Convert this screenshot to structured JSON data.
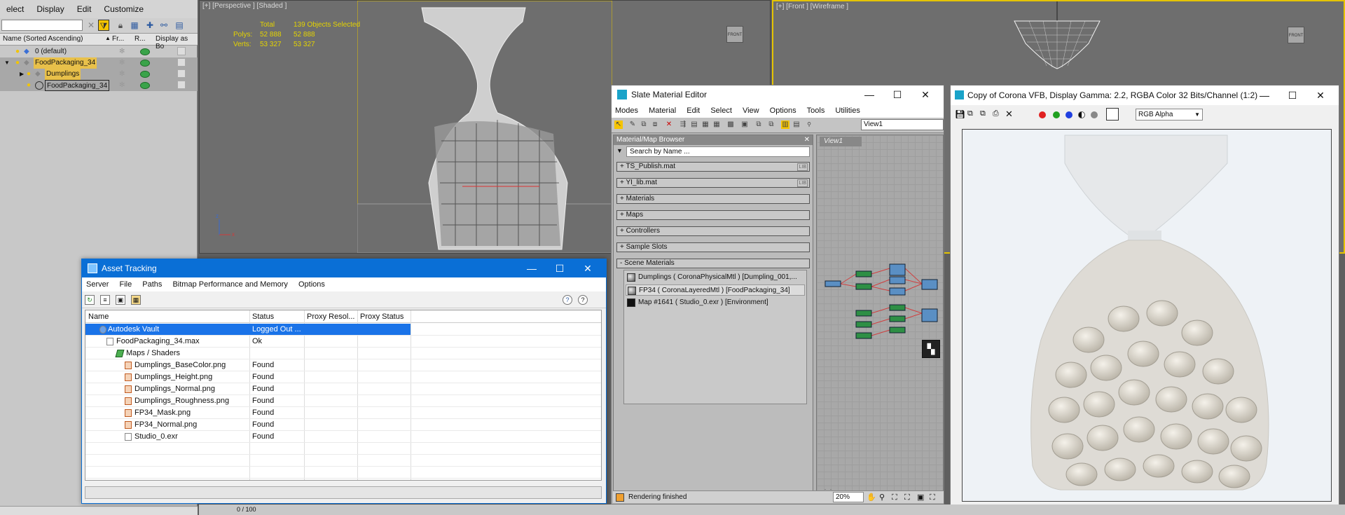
{
  "explorer": {
    "menu": [
      "elect",
      "Display",
      "Edit",
      "Customize"
    ],
    "columns": [
      "Name (Sorted Ascending)",
      "Fr...",
      "R...",
      "Display as Bo"
    ],
    "rows": [
      {
        "name": "0 (default)",
        "level": 0,
        "selected": false
      },
      {
        "name": "FoodPackaging_34",
        "level": 0,
        "selected": true
      },
      {
        "name": "Dumplings",
        "level": 1,
        "selected": true
      },
      {
        "name": "FoodPackaging_34",
        "level": 1,
        "selected": false,
        "boxed": true
      }
    ]
  },
  "viewport_persp": {
    "label": "[+] [Perspective ] [Shaded ]",
    "stats_header_total": "Total",
    "stats_header_selected": "139 Objects Selected",
    "polys_label": "Polys:",
    "polys_total": "52 888",
    "polys_selected": "52 888",
    "verts_label": "Verts:",
    "verts_total": "53 327",
    "verts_selected": "53 327",
    "cube": "FRONT"
  },
  "viewport_front": {
    "label": "[+] [Front ] [Wireframe ]",
    "cube": "FRONT"
  },
  "asset": {
    "title": "Asset Tracking",
    "menu": [
      "Server",
      "File",
      "Paths",
      "Bitmap Performance and Memory",
      "Options"
    ],
    "columns": [
      "Name",
      "Status",
      "Proxy Resol...",
      "Proxy Status"
    ],
    "rows": [
      {
        "name": "Autodesk Vault",
        "status": "Logged Out ...",
        "indent": 0,
        "type": "vault"
      },
      {
        "name": "FoodPackaging_34.max",
        "status": "Ok",
        "indent": 1,
        "type": "file"
      },
      {
        "name": "Maps / Shaders",
        "status": "",
        "indent": 2,
        "type": "folder"
      },
      {
        "name": "Dumplings_BaseColor.png",
        "status": "Found",
        "indent": 3,
        "type": "img"
      },
      {
        "name": "Dumplings_Height.png",
        "status": "Found",
        "indent": 3,
        "type": "img"
      },
      {
        "name": "Dumplings_Normal.png",
        "status": "Found",
        "indent": 3,
        "type": "img"
      },
      {
        "name": "Dumplings_Roughness.png",
        "status": "Found",
        "indent": 3,
        "type": "img"
      },
      {
        "name": "FP34_Mask.png",
        "status": "Found",
        "indent": 3,
        "type": "img"
      },
      {
        "name": "FP34_Normal.png",
        "status": "Found",
        "indent": 3,
        "type": "img"
      },
      {
        "name": "Studio_0.exr",
        "status": "Found",
        "indent": 3,
        "type": "file"
      }
    ]
  },
  "slate": {
    "title": "Slate Material Editor",
    "menu": [
      "Modes",
      "Material",
      "Edit",
      "Select",
      "View",
      "Options",
      "Tools",
      "Utilities"
    ],
    "view_select": "View1",
    "browser_title": "Material/Map Browser",
    "search_placeholder": "Search by Name ...",
    "groups": [
      {
        "label": "+ TS_Publish.mat",
        "lib": "LIB"
      },
      {
        "label": "+ YI_lib.mat",
        "lib": "LIB"
      },
      {
        "label": "+ Materials",
        "lib": ""
      },
      {
        "label": "+ Maps",
        "lib": ""
      },
      {
        "label": "+ Controllers",
        "lib": ""
      },
      {
        "label": "+ Sample Slots",
        "lib": ""
      },
      {
        "label": "- Scene Materials",
        "lib": ""
      }
    ],
    "scene_materials": [
      "Dumplings  ( CoronaPhysicalMtl ) [Dumpling_001,...",
      "FP34  ( CoronaLayeredMtl ) [FoodPackaging_34]",
      "Map #1641 ( Studio_0.exr ) [Environment]"
    ],
    "view_tab": "View1",
    "status": "Rendering finished",
    "zoom": "20%"
  },
  "vfb": {
    "title": "Copy of Corona VFB, Display Gamma: 2.2, RGBA Color 32 Bits/Channel (1:2)",
    "channel": "RGB Alpha"
  },
  "timeline": {
    "frame": "0 / 100"
  }
}
